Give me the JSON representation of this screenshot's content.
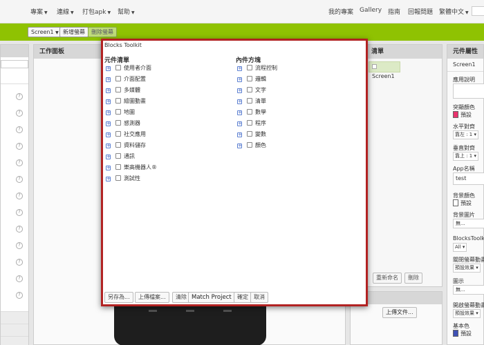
{
  "topnav": {
    "menus": [
      "專案",
      "連線",
      "打包apk",
      "幫助"
    ],
    "links": [
      "我的專案",
      "Gallery",
      "指南",
      "回報問題",
      "繁體中文"
    ]
  },
  "toolbar": {
    "screen_select": "Screen1",
    "add_screen": "新增螢幕",
    "remove_screen": "刪除螢幕"
  },
  "work_panel": {
    "title": "工作面板"
  },
  "comp_panel": {
    "title": "清單",
    "item": "Screen1",
    "rename": "重新命名",
    "delete": "刪除",
    "upload": "上傳文件..."
  },
  "prop_panel": {
    "title": "元件屬性",
    "component": "Screen1",
    "app_desc": "應用說明",
    "accent_color": "突顯顏色",
    "accent_value": "預設",
    "align_h": "水平對齊",
    "align_h_value": "靠左 : 1",
    "align_v": "垂直對齊",
    "align_v_value": "靠上 : 1",
    "app_name": "App名稱",
    "app_name_value": "test",
    "bg_color": "背景顏色",
    "bg_color_value": "預設",
    "bg_image": "背景圖片",
    "bg_image_value": "無...",
    "blocks_toolkit": "BlocksToolkit",
    "blocks_toolkit_value": "All",
    "close_anim": "關閉螢幕動畫",
    "close_anim_value": "預設效果",
    "icon": "圖示",
    "icon_value": "無...",
    "open_anim": "開啟螢幕動畫",
    "open_anim_value": "預設效果",
    "primary_color": "基本色",
    "primary_color_value": "預設",
    "colors": {
      "accent": "#e8336d",
      "primary": "#3f51b5",
      "background": "#ffffff"
    }
  },
  "dialog": {
    "title": "Blocks Toolkit",
    "components_header": "元件清單",
    "builtin_header": "內件方塊",
    "components": [
      "使用者介面",
      "介面配置",
      "多媒體",
      "繪圖動畫",
      "地圖",
      "感測器",
      "社交應用",
      "資料儲存",
      "通訊",
      "樂高機器人®",
      "測試性"
    ],
    "builtins": [
      "流程控制",
      "邏輯",
      "文字",
      "清單",
      "數學",
      "程序",
      "變數",
      "顏色"
    ],
    "buttons": {
      "save_as": "另存為...",
      "upload": "上傳檔案...",
      "clear": "清除",
      "match": "Match Project",
      "ok": "確定",
      "cancel": "取消"
    }
  }
}
